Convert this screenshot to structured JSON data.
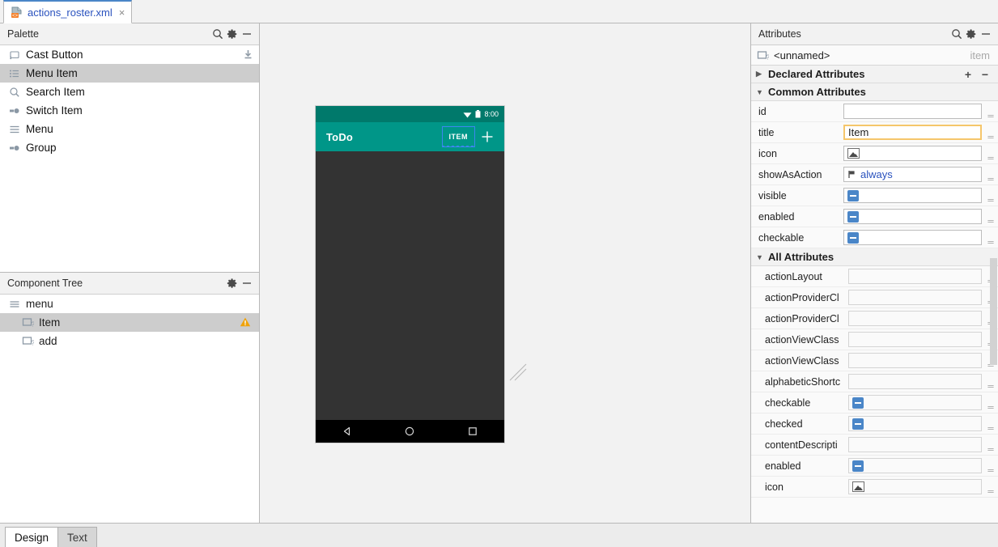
{
  "editor_tab": {
    "filename": "actions_roster.xml",
    "close_label": "×",
    "icon": "android-xml-icon"
  },
  "palette": {
    "title": "Palette",
    "search_icon": "search-icon",
    "gear_icon": "gear-icon",
    "minimize_icon": "minimize-icon",
    "download_icon": "download-icon",
    "items": [
      {
        "label": "Cast Button",
        "icon": "cast-icon",
        "selected": false
      },
      {
        "label": "Menu Item",
        "icon": "menu-item-icon",
        "selected": true
      },
      {
        "label": "Search Item",
        "icon": "search-item-icon",
        "selected": false
      },
      {
        "label": "Switch Item",
        "icon": "switch-item-icon",
        "selected": false
      },
      {
        "label": "Menu",
        "icon": "menu-icon",
        "selected": false
      },
      {
        "label": "Group",
        "icon": "group-icon",
        "selected": false
      }
    ]
  },
  "component_tree": {
    "title": "Component Tree",
    "gear_icon": "gear-icon",
    "minimize_icon": "minimize-icon",
    "nodes": [
      {
        "label": "menu",
        "icon": "menu-icon",
        "depth": 0,
        "selected": false,
        "warning": false
      },
      {
        "label": "Item",
        "icon": "unknown-view-icon",
        "depth": 1,
        "selected": true,
        "warning": true
      },
      {
        "label": "add",
        "icon": "unknown-view-icon",
        "depth": 1,
        "selected": false,
        "warning": false
      }
    ],
    "warning_icon": "warning-triangle-icon"
  },
  "preview": {
    "status_time": "8:00",
    "wifi_icon": "wifi-icon",
    "battery_icon": "battery-icon",
    "app_title": "ToDo",
    "action_item_label": "ITEM",
    "add_icon": "plus-icon",
    "nav_back_icon": "nav-back-triangle-icon",
    "nav_home_icon": "nav-home-circle-icon",
    "nav_recents_icon": "nav-recents-square-icon",
    "resize_handle_icon": "resize-handle-icon",
    "colors": {
      "status_bar": "#00796b",
      "app_bar": "#009688",
      "body": "#333333",
      "nav_bar": "#000000",
      "selection": "#3d86f0"
    }
  },
  "attributes": {
    "title": "Attributes",
    "search_icon": "search-icon",
    "gear_icon": "gear-icon",
    "minimize_icon": "minimize-icon",
    "selected_component": "<unnamed>",
    "selected_type": "item",
    "component_icon": "unknown-view-icon",
    "declared": {
      "title": "Declared Attributes",
      "expanded": false,
      "add_label": "+",
      "remove_label": "−"
    },
    "common": {
      "title": "Common Attributes",
      "expanded": true,
      "rows": [
        {
          "name": "id",
          "value": "",
          "widget": "text",
          "focused": false,
          "brace": false
        },
        {
          "name": "title",
          "value": "Item",
          "widget": "text",
          "focused": true,
          "brace": true
        },
        {
          "name": "icon",
          "value": "",
          "widget": "image",
          "focused": false,
          "brace": true
        },
        {
          "name": "showAsAction",
          "value": "always",
          "widget": "flag",
          "focused": false,
          "brace": true
        },
        {
          "name": "visible",
          "value": "",
          "widget": "tristate",
          "focused": false,
          "brace": true
        },
        {
          "name": "enabled",
          "value": "",
          "widget": "tristate",
          "focused": false,
          "brace": true
        },
        {
          "name": "checkable",
          "value": "",
          "widget": "tristate",
          "focused": false,
          "brace": true
        }
      ]
    },
    "all": {
      "title": "All Attributes",
      "expanded": true,
      "rows": [
        {
          "name": "actionLayout",
          "value": "",
          "widget": "text"
        },
        {
          "name": "actionProviderCl",
          "value": "",
          "widget": "text"
        },
        {
          "name": "actionProviderCl",
          "value": "",
          "widget": "text"
        },
        {
          "name": "actionViewClass",
          "value": "",
          "widget": "text"
        },
        {
          "name": "actionViewClass",
          "value": "",
          "widget": "text"
        },
        {
          "name": "alphabeticShortc",
          "value": "",
          "widget": "text"
        },
        {
          "name": "checkable",
          "value": "",
          "widget": "tristate"
        },
        {
          "name": "checked",
          "value": "",
          "widget": "tristate"
        },
        {
          "name": "contentDescripti",
          "value": "",
          "widget": "text"
        },
        {
          "name": "enabled",
          "value": "",
          "widget": "tristate"
        },
        {
          "name": "icon",
          "value": "",
          "widget": "image"
        }
      ]
    },
    "brace_glyph": "{}"
  },
  "bottom_tabs": [
    {
      "label": "Design",
      "active": true
    },
    {
      "label": "Text",
      "active": false
    }
  ]
}
